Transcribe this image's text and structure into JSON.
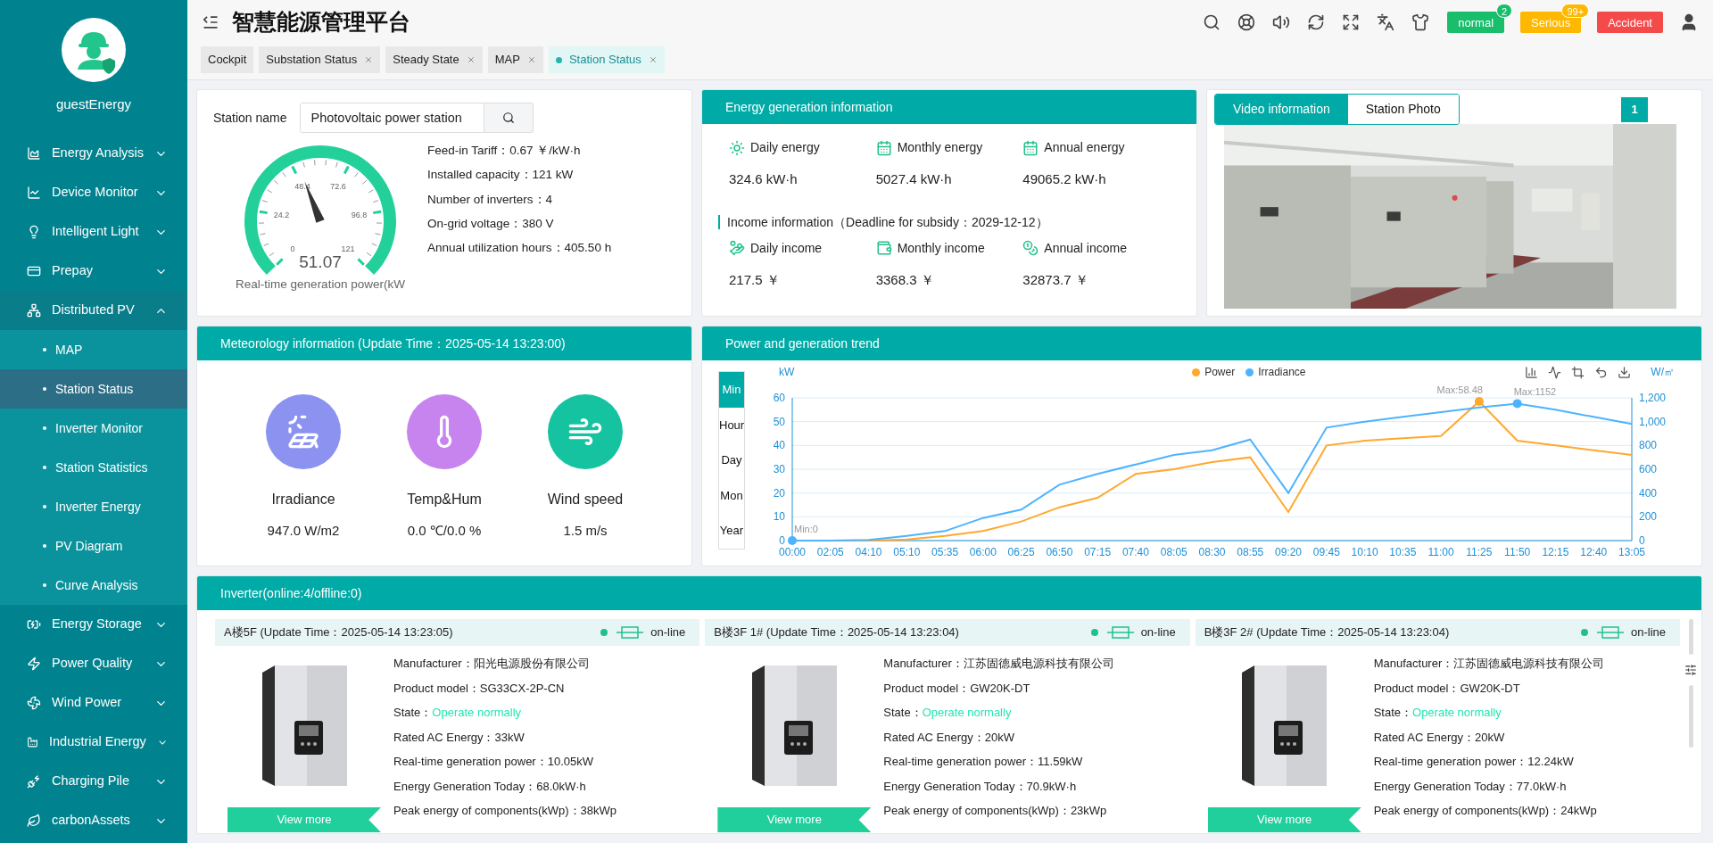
{
  "sidebar": {
    "user": "guestEnergy",
    "items": [
      {
        "label": "Energy Analysis",
        "expanded": false
      },
      {
        "label": "Device Monitor",
        "expanded": false
      },
      {
        "label": "Intelligent Light",
        "expanded": false
      },
      {
        "label": "Prepay",
        "expanded": false
      },
      {
        "label": "Distributed PV",
        "expanded": true,
        "children": [
          {
            "label": "MAP",
            "selected": false
          },
          {
            "label": "Station Status",
            "selected": true
          },
          {
            "label": "Inverter Monitor",
            "selected": false
          },
          {
            "label": "Station Statistics",
            "selected": false
          },
          {
            "label": "Inverter Energy",
            "selected": false
          },
          {
            "label": "PV Diagram",
            "selected": false
          },
          {
            "label": "Curve Analysis",
            "selected": false
          }
        ]
      },
      {
        "label": "Energy Storage",
        "expanded": false
      },
      {
        "label": "Power Quality",
        "expanded": false
      },
      {
        "label": "Wind Power",
        "expanded": false
      },
      {
        "label": "Industrial Energy",
        "expanded": false
      },
      {
        "label": "Charging Pile",
        "expanded": false
      },
      {
        "label": "carbonAssets",
        "expanded": false
      }
    ]
  },
  "header": {
    "title": "智慧能源管理平台",
    "alarms": [
      {
        "label": "normal",
        "count": "2",
        "color": "#19be6b"
      },
      {
        "label": "Serious",
        "count": "99+",
        "color": "#ffb800"
      },
      {
        "label": "Accident",
        "color": "#f54a4a"
      }
    ]
  },
  "tabs": [
    {
      "label": "Cockpit",
      "selected": false,
      "closable": false
    },
    {
      "label": "Substation Status",
      "selected": false,
      "closable": true
    },
    {
      "label": "Steady State",
      "selected": false,
      "closable": true
    },
    {
      "label": "MAP",
      "selected": false,
      "closable": true
    },
    {
      "label": "Station Status",
      "selected": true,
      "closable": true
    }
  ],
  "station": {
    "name_label": "Station name",
    "name_value": "Photovoltaic power station",
    "gauge": {
      "value": "51.07",
      "level": 0.42,
      "scale": [
        "0",
        "24.2",
        "48.4",
        "72.6",
        "96.8",
        "121"
      ],
      "caption": "Real-time generation power(kW"
    },
    "info": [
      {
        "label": "Feed-in Tariff：",
        "value": "0.67 ￥/kW·h"
      },
      {
        "label": "Installed capacity：",
        "value": "121 kW"
      },
      {
        "label": "Number of inverters：",
        "value": "4"
      },
      {
        "label": "On-grid voltage：",
        "value": "380 V"
      },
      {
        "label": "Annual utilization hours：",
        "value": "405.50 h"
      }
    ]
  },
  "energy": {
    "title": "Energy generation information",
    "generation": [
      {
        "label": "Daily energy",
        "value": "324.6 kW·h"
      },
      {
        "label": "Monthly energy",
        "value": "5027.4 kW·h"
      },
      {
        "label": "Annual energy",
        "value": "49065.2 kW·h"
      }
    ],
    "income_title": "Income information（Deadline for subsidy：2029-12-12）",
    "income": [
      {
        "label": "Daily income",
        "value": "217.5 ￥"
      },
      {
        "label": "Monthly income",
        "value": "3368.3 ￥"
      },
      {
        "label": "Annual income",
        "value": "32873.7 ￥"
      }
    ]
  },
  "video": {
    "tabs": [
      {
        "label": "Video information",
        "selected": true
      },
      {
        "label": "Station Photo",
        "selected": false
      }
    ],
    "channel": "1"
  },
  "meteorology": {
    "title": "Meteorology information (Update Time：2025-05-14 13:23:00)",
    "items": [
      {
        "label": "Irradiance",
        "value": "947.0 W/m2"
      },
      {
        "label": "Temp&Hum",
        "value": "0.0 ℃/0.0 %"
      },
      {
        "label": "Wind speed",
        "value": "1.5 m/s"
      }
    ]
  },
  "trend": {
    "title": "Power and generation trend",
    "ranges": [
      {
        "label": "Min",
        "selected": true
      },
      {
        "label": "Hour",
        "selected": false
      },
      {
        "label": "Day",
        "selected": false
      },
      {
        "label": "Mon",
        "selected": false
      },
      {
        "label": "Year",
        "selected": false
      }
    ],
    "chart_data": {
      "type": "line",
      "grid": true,
      "ylabel": "kW",
      "y2label": "W/㎡",
      "categories": [
        "00:00",
        "02:05",
        "04:10",
        "05:10",
        "05:35",
        "06:00",
        "06:25",
        "06:50",
        "07:15",
        "07:40",
        "08:05",
        "08:30",
        "08:55",
        "09:20",
        "09:45",
        "10:10",
        "10:35",
        "11:00",
        "11:25",
        "11:50",
        "12:15",
        "12:40",
        "13:05"
      ],
      "series": [
        {
          "name": "Power",
          "color": "#ffa82e",
          "values": [
            0,
            0,
            0,
            0.5,
            2,
            4,
            8,
            14,
            18,
            28,
            30,
            33,
            35,
            12,
            40,
            42,
            43,
            44,
            58.5,
            42,
            40,
            38,
            36
          ]
        },
        {
          "name": "Irradiance",
          "color": "#4db3ff",
          "axis": "y2",
          "values": [
            0,
            0,
            5,
            40,
            80,
            190,
            260,
            470,
            560,
            640,
            720,
            760,
            850,
            400,
            950,
            1000,
            1040,
            1080,
            1120,
            1152,
            1100,
            1040,
            980
          ]
        }
      ],
      "ylim": [
        0,
        60
      ],
      "yticks": [
        0,
        10,
        20,
        30,
        40,
        50,
        60
      ],
      "y2lim": [
        0,
        1200
      ],
      "y2ticks": [
        0,
        200,
        400,
        600,
        800,
        {
          "value": 1000,
          "label": "1,000"
        },
        {
          "value": 1200,
          "label": "1,200"
        }
      ]
    },
    "series_markers": [
      [
        {
          "label": "Max:58.48",
          "kind": "max"
        }
      ],
      [
        {
          "label": "Min:0",
          "kind": "min"
        },
        {
          "label": "Max:1152",
          "kind": "max"
        }
      ]
    ]
  },
  "inverters": {
    "title": "Inverter(online:4/offline:0)",
    "cards": [
      {
        "title": "A楼5F (Update Time：2025-05-14 13:23:05)",
        "online": true,
        "status": "on-line",
        "button": "View more",
        "fields": [
          {
            "kind": "text",
            "label": "Manufacturer：",
            "value": "阳光电源股份有限公司"
          },
          {
            "kind": "text",
            "label": "Product model：",
            "value": "SG33CX-2P-CN"
          },
          {
            "kind": "status",
            "label": "State：",
            "value": "Operate normally"
          },
          {
            "kind": "text",
            "label": "Rated AC Energy：",
            "value": "33kW"
          },
          {
            "kind": "text",
            "label": "Real-time generation power：",
            "value": "10.05kW"
          },
          {
            "kind": "text",
            "label": "Energy Generation Today：",
            "value": "68.0kW·h"
          },
          {
            "kind": "text",
            "label": "Peak energy of components(kWp)：",
            "value": "38kWp"
          }
        ]
      },
      {
        "title": "B楼3F 1# (Update Time：2025-05-14 13:23:04)",
        "online": true,
        "status": "on-line",
        "button": "View more",
        "fields": [
          {
            "kind": "text",
            "label": "Manufacturer：",
            "value": "江苏固德威电源科技有限公司"
          },
          {
            "kind": "text",
            "label": "Product model：",
            "value": "GW20K-DT"
          },
          {
            "kind": "status",
            "label": "State：",
            "value": "Operate normally"
          },
          {
            "kind": "text",
            "label": "Rated AC Energy：",
            "value": "20kW"
          },
          {
            "kind": "text",
            "label": "Real-time generation power：",
            "value": "11.59kW"
          },
          {
            "kind": "text",
            "label": "Energy Generation Today：",
            "value": "70.9kW·h"
          },
          {
            "kind": "text",
            "label": "Peak energy of components(kWp)：",
            "value": "23kWp"
          }
        ]
      },
      {
        "title": "B楼3F 2# (Update Time：2025-05-14 13:23:04)",
        "online": true,
        "status": "on-line",
        "button": "View more",
        "fields": [
          {
            "kind": "text",
            "label": "Manufacturer：",
            "value": "江苏固德威电源科技有限公司"
          },
          {
            "kind": "text",
            "label": "Product model：",
            "value": "GW20K-DT"
          },
          {
            "kind": "status",
            "label": "State：",
            "value": "Operate normally"
          },
          {
            "kind": "text",
            "label": "Rated AC Energy：",
            "value": "20kW"
          },
          {
            "kind": "text",
            "label": "Real-time generation power：",
            "value": "12.24kW"
          },
          {
            "kind": "text",
            "label": "Energy Generation Today：",
            "value": "77.0kW·h"
          },
          {
            "kind": "text",
            "label": "Peak energy of components(kWp)：",
            "value": "24kWp"
          }
        ]
      }
    ]
  }
}
